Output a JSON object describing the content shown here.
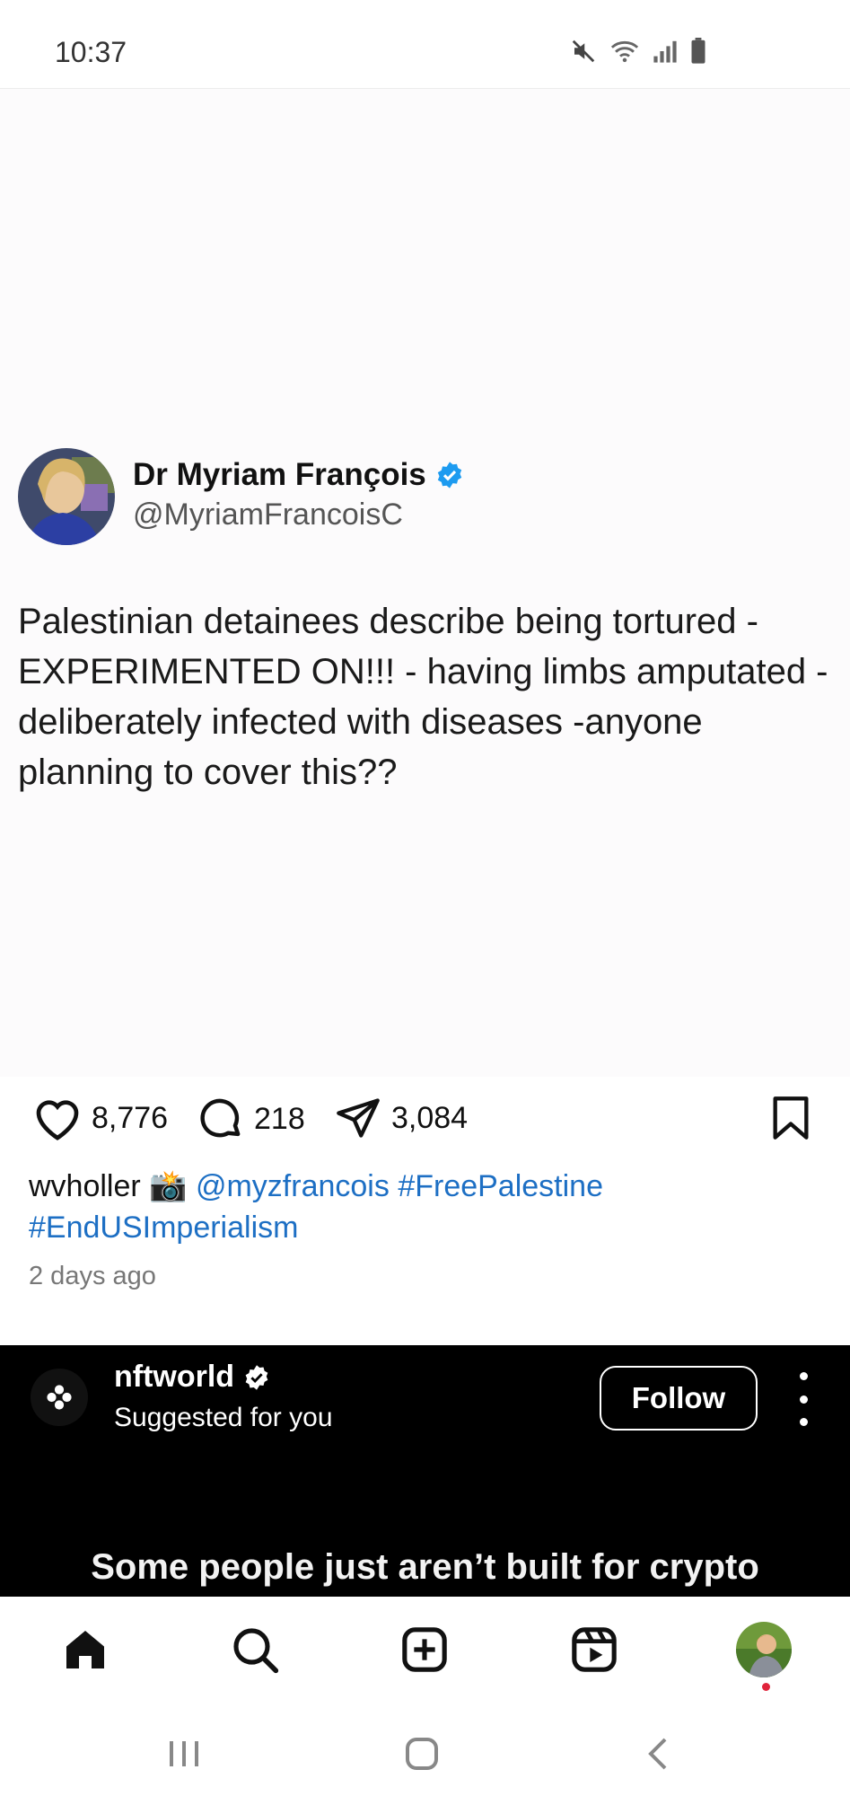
{
  "status_bar": {
    "time": "10:37",
    "icons": [
      "mute-icon",
      "wifi-icon",
      "signal-icon",
      "battery-icon"
    ]
  },
  "tweet": {
    "author_name": "Dr Myriam François",
    "author_handle": "@MyriamFrancoisC",
    "verified": true,
    "text": "Palestinian detainees describe being tortured - EXPERIMENTED ON!!! - having limbs amputated - deliberately infected with diseases -anyone planning to cover this??"
  },
  "actions": {
    "likes": "8,776",
    "comments": "218",
    "shares": "3,084"
  },
  "caption": {
    "username": "wvholler",
    "emoji": "📸",
    "mention": "@myzfrancois",
    "hashtag1": "#FreePalestine",
    "hashtag2": "#EndUSImperialism"
  },
  "time_ago": "2 days ago",
  "suggested": {
    "name": "nftworld",
    "subtitle": "Suggested for you",
    "follow_label": "Follow",
    "caption": "Some people just aren’t built for crypto"
  },
  "bottom_nav": [
    "home-icon",
    "search-icon",
    "create-icon",
    "reels-icon",
    "profile-avatar"
  ],
  "colors": {
    "link": "#1d6fc4",
    "verified": "#1d9bf0",
    "notification": "#e0243b"
  }
}
